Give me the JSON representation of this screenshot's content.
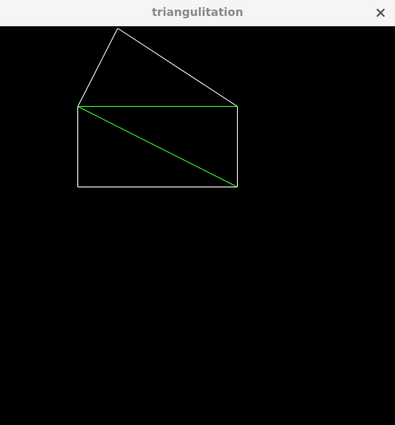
{
  "window": {
    "title": "triangulitation",
    "close_icon": "close-icon"
  },
  "canvas": {
    "background": "#000000",
    "polygon_color": "#ffffff",
    "triangulation_color": "#33ff33"
  }
}
